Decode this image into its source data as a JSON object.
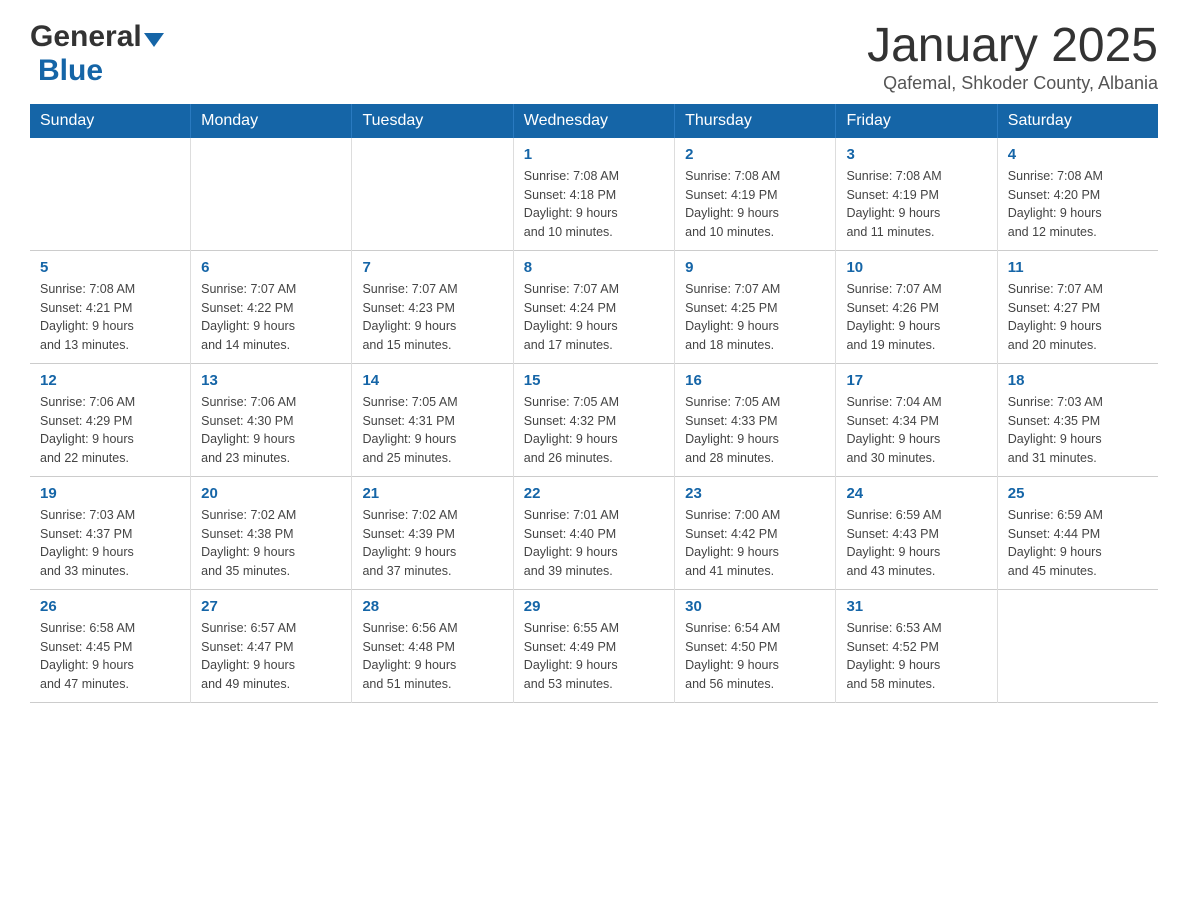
{
  "header": {
    "logo_general": "General",
    "logo_blue": "Blue",
    "title": "January 2025",
    "subtitle": "Qafemal, Shkoder County, Albania"
  },
  "days_of_week": [
    "Sunday",
    "Monday",
    "Tuesday",
    "Wednesday",
    "Thursday",
    "Friday",
    "Saturday"
  ],
  "weeks": [
    [
      {
        "day": "",
        "info": ""
      },
      {
        "day": "",
        "info": ""
      },
      {
        "day": "",
        "info": ""
      },
      {
        "day": "1",
        "info": "Sunrise: 7:08 AM\nSunset: 4:18 PM\nDaylight: 9 hours\nand 10 minutes."
      },
      {
        "day": "2",
        "info": "Sunrise: 7:08 AM\nSunset: 4:19 PM\nDaylight: 9 hours\nand 10 minutes."
      },
      {
        "day": "3",
        "info": "Sunrise: 7:08 AM\nSunset: 4:19 PM\nDaylight: 9 hours\nand 11 minutes."
      },
      {
        "day": "4",
        "info": "Sunrise: 7:08 AM\nSunset: 4:20 PM\nDaylight: 9 hours\nand 12 minutes."
      }
    ],
    [
      {
        "day": "5",
        "info": "Sunrise: 7:08 AM\nSunset: 4:21 PM\nDaylight: 9 hours\nand 13 minutes."
      },
      {
        "day": "6",
        "info": "Sunrise: 7:07 AM\nSunset: 4:22 PM\nDaylight: 9 hours\nand 14 minutes."
      },
      {
        "day": "7",
        "info": "Sunrise: 7:07 AM\nSunset: 4:23 PM\nDaylight: 9 hours\nand 15 minutes."
      },
      {
        "day": "8",
        "info": "Sunrise: 7:07 AM\nSunset: 4:24 PM\nDaylight: 9 hours\nand 17 minutes."
      },
      {
        "day": "9",
        "info": "Sunrise: 7:07 AM\nSunset: 4:25 PM\nDaylight: 9 hours\nand 18 minutes."
      },
      {
        "day": "10",
        "info": "Sunrise: 7:07 AM\nSunset: 4:26 PM\nDaylight: 9 hours\nand 19 minutes."
      },
      {
        "day": "11",
        "info": "Sunrise: 7:07 AM\nSunset: 4:27 PM\nDaylight: 9 hours\nand 20 minutes."
      }
    ],
    [
      {
        "day": "12",
        "info": "Sunrise: 7:06 AM\nSunset: 4:29 PM\nDaylight: 9 hours\nand 22 minutes."
      },
      {
        "day": "13",
        "info": "Sunrise: 7:06 AM\nSunset: 4:30 PM\nDaylight: 9 hours\nand 23 minutes."
      },
      {
        "day": "14",
        "info": "Sunrise: 7:05 AM\nSunset: 4:31 PM\nDaylight: 9 hours\nand 25 minutes."
      },
      {
        "day": "15",
        "info": "Sunrise: 7:05 AM\nSunset: 4:32 PM\nDaylight: 9 hours\nand 26 minutes."
      },
      {
        "day": "16",
        "info": "Sunrise: 7:05 AM\nSunset: 4:33 PM\nDaylight: 9 hours\nand 28 minutes."
      },
      {
        "day": "17",
        "info": "Sunrise: 7:04 AM\nSunset: 4:34 PM\nDaylight: 9 hours\nand 30 minutes."
      },
      {
        "day": "18",
        "info": "Sunrise: 7:03 AM\nSunset: 4:35 PM\nDaylight: 9 hours\nand 31 minutes."
      }
    ],
    [
      {
        "day": "19",
        "info": "Sunrise: 7:03 AM\nSunset: 4:37 PM\nDaylight: 9 hours\nand 33 minutes."
      },
      {
        "day": "20",
        "info": "Sunrise: 7:02 AM\nSunset: 4:38 PM\nDaylight: 9 hours\nand 35 minutes."
      },
      {
        "day": "21",
        "info": "Sunrise: 7:02 AM\nSunset: 4:39 PM\nDaylight: 9 hours\nand 37 minutes."
      },
      {
        "day": "22",
        "info": "Sunrise: 7:01 AM\nSunset: 4:40 PM\nDaylight: 9 hours\nand 39 minutes."
      },
      {
        "day": "23",
        "info": "Sunrise: 7:00 AM\nSunset: 4:42 PM\nDaylight: 9 hours\nand 41 minutes."
      },
      {
        "day": "24",
        "info": "Sunrise: 6:59 AM\nSunset: 4:43 PM\nDaylight: 9 hours\nand 43 minutes."
      },
      {
        "day": "25",
        "info": "Sunrise: 6:59 AM\nSunset: 4:44 PM\nDaylight: 9 hours\nand 45 minutes."
      }
    ],
    [
      {
        "day": "26",
        "info": "Sunrise: 6:58 AM\nSunset: 4:45 PM\nDaylight: 9 hours\nand 47 minutes."
      },
      {
        "day": "27",
        "info": "Sunrise: 6:57 AM\nSunset: 4:47 PM\nDaylight: 9 hours\nand 49 minutes."
      },
      {
        "day": "28",
        "info": "Sunrise: 6:56 AM\nSunset: 4:48 PM\nDaylight: 9 hours\nand 51 minutes."
      },
      {
        "day": "29",
        "info": "Sunrise: 6:55 AM\nSunset: 4:49 PM\nDaylight: 9 hours\nand 53 minutes."
      },
      {
        "day": "30",
        "info": "Sunrise: 6:54 AM\nSunset: 4:50 PM\nDaylight: 9 hours\nand 56 minutes."
      },
      {
        "day": "31",
        "info": "Sunrise: 6:53 AM\nSunset: 4:52 PM\nDaylight: 9 hours\nand 58 minutes."
      },
      {
        "day": "",
        "info": ""
      }
    ]
  ]
}
